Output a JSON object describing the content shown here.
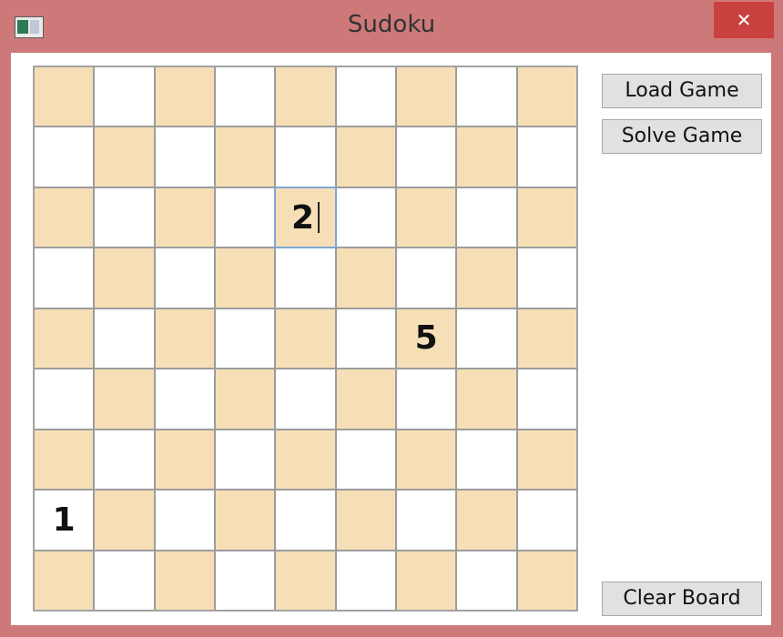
{
  "window": {
    "title": "Sudoku",
    "close_glyph": "✕",
    "app_icon": "window-app-icon"
  },
  "buttons": {
    "load_label": "Load Game",
    "solve_label": "Solve Game",
    "clear_label": "Clear Board"
  },
  "board": {
    "cells": [
      [
        "",
        "",
        "",
        "",
        "",
        "",
        "",
        "",
        ""
      ],
      [
        "",
        "",
        "",
        "",
        "",
        "",
        "",
        "",
        ""
      ],
      [
        "",
        "",
        "",
        "",
        "2",
        "",
        "",
        "",
        ""
      ],
      [
        "",
        "",
        "",
        "",
        "",
        "",
        "",
        "",
        ""
      ],
      [
        "",
        "",
        "",
        "",
        "",
        "",
        "5",
        "",
        ""
      ],
      [
        "",
        "",
        "",
        "",
        "",
        "",
        "",
        "",
        ""
      ],
      [
        "",
        "",
        "",
        "",
        "",
        "",
        "",
        "",
        ""
      ],
      [
        "1",
        "",
        "",
        "",
        "",
        "",
        "",
        "",
        ""
      ],
      [
        "",
        "",
        "",
        "",
        "",
        "",
        "",
        "",
        ""
      ]
    ],
    "focused_cell": {
      "row": 3,
      "col": 5
    },
    "colors": {
      "shade": "#f6dfb7",
      "plain": "#ffffff",
      "grid": "#a9a9a9"
    }
  }
}
